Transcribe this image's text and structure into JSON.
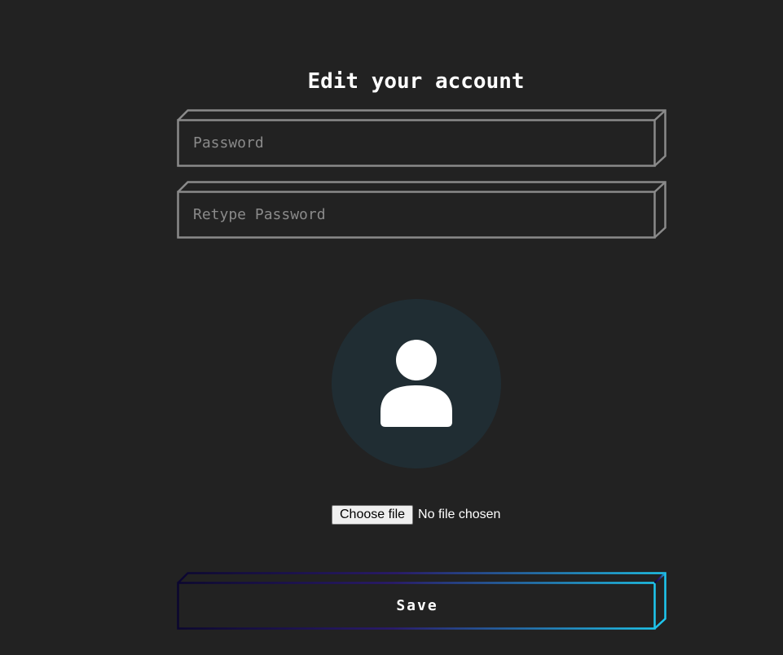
{
  "form": {
    "title": "Edit your account",
    "password": {
      "placeholder": "Password",
      "value": ""
    },
    "retype_password": {
      "placeholder": "Retype Password",
      "value": ""
    },
    "avatar": {
      "icon": "user-silhouette-icon"
    },
    "file_input": {
      "button_label": "Choose file",
      "status_text": "No file chosen"
    },
    "save_label": "Save"
  },
  "colors": {
    "background": "#222222",
    "field_border": "#8a8a8a",
    "avatar_bg": "#202d33",
    "save_gradient_start": "#0b0630",
    "save_gradient_end": "#1ec8f0",
    "text": "#ffffff"
  }
}
